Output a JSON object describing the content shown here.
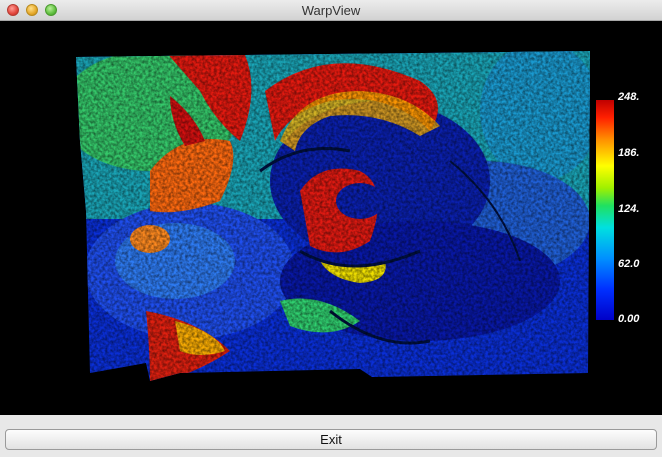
{
  "window": {
    "title": "WarpView"
  },
  "legend": {
    "ticks": [
      "248.",
      "186.",
      "124.",
      "62.0",
      "0.00"
    ]
  },
  "buttons": {
    "exit_label": "Exit"
  },
  "colors": {
    "low": "#0000c8",
    "mid": "#00e0e0",
    "high": "#ffff00",
    "max": "#c00000",
    "background": "#000000"
  }
}
